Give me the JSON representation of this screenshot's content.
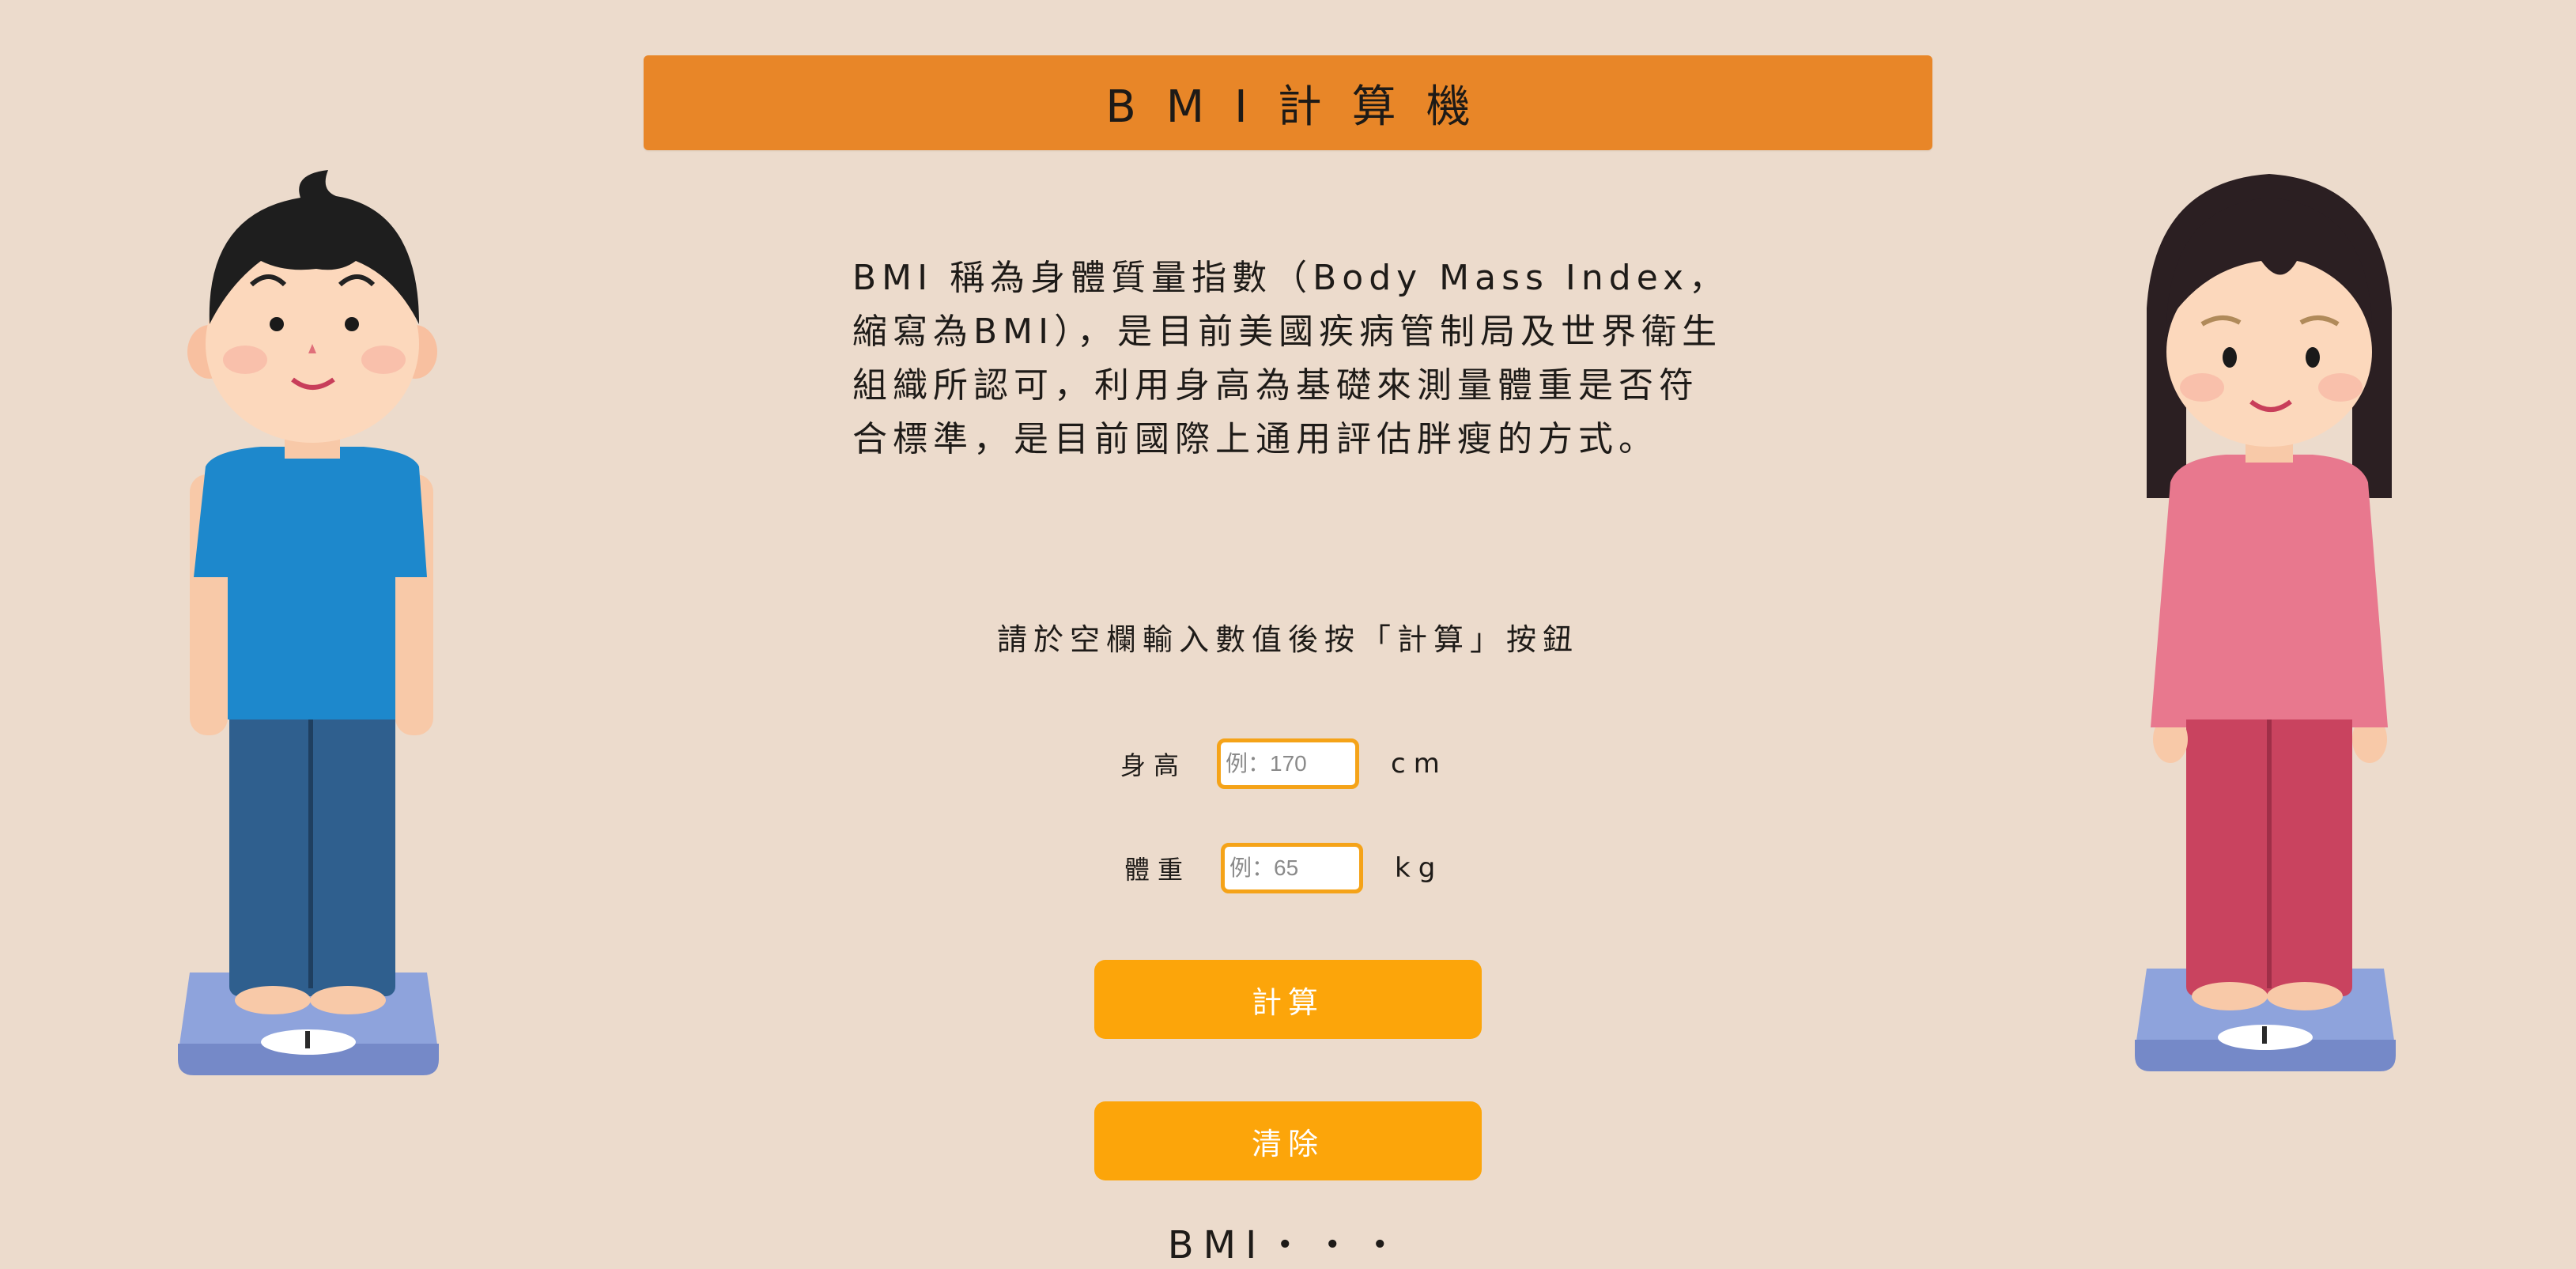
{
  "header": {
    "title": "BMI計算機"
  },
  "intro": {
    "text": "BMI 稱為身體質量指數（Body Mass Index，縮寫為BMI），是目前美國疾病管制局及世界衛生組織所認可，利用身高為基礎來測量體重是否符合標準，是目前國際上通用評估胖瘦的方式。"
  },
  "form": {
    "instruction": "請於空欄輸入數值後按「計算」按鈕",
    "height": {
      "label": "身高",
      "placeholder": "例：170",
      "value": "",
      "unit": "cm"
    },
    "weight": {
      "label": "體重",
      "placeholder": "例：65",
      "value": "",
      "unit": "kg"
    }
  },
  "buttons": {
    "calculate": "計算",
    "clear": "清除"
  },
  "result": {
    "label": "BMI・・・"
  },
  "colors": {
    "background": "#ecdbcc",
    "title_bar": "#e88628",
    "button": "#fca50a",
    "input_border": "#f5a318"
  },
  "illustrations": {
    "left": "boy-on-scale-illustration",
    "right": "girl-on-scale-illustration"
  }
}
